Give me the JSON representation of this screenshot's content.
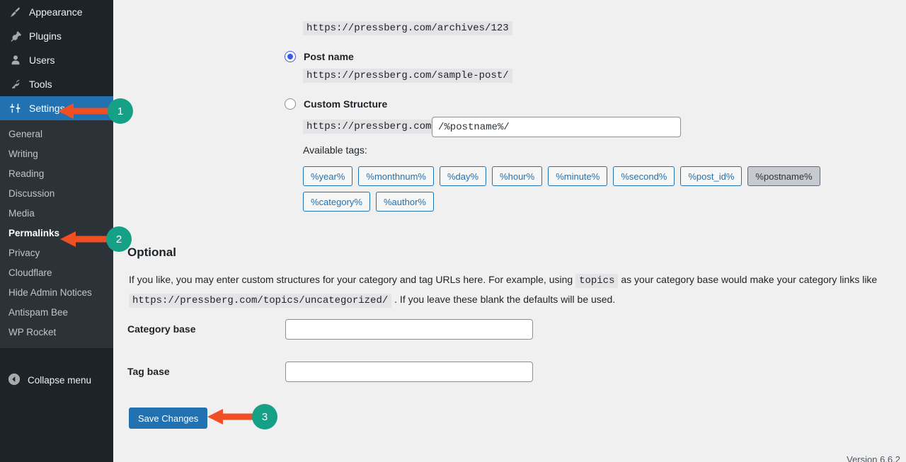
{
  "sidebar": {
    "menu": [
      {
        "label": "Appearance",
        "icon": "paintbrush-icon",
        "active": false
      },
      {
        "label": "Plugins",
        "icon": "plug-icon",
        "active": false
      },
      {
        "label": "Users",
        "icon": "user-icon",
        "active": false
      },
      {
        "label": "Tools",
        "icon": "wrench-icon",
        "active": false
      },
      {
        "label": "Settings",
        "icon": "sliders-icon",
        "active": true
      }
    ],
    "submenu": [
      {
        "label": "General",
        "current": false
      },
      {
        "label": "Writing",
        "current": false
      },
      {
        "label": "Reading",
        "current": false
      },
      {
        "label": "Discussion",
        "current": false
      },
      {
        "label": "Media",
        "current": false
      },
      {
        "label": "Permalinks",
        "current": true
      },
      {
        "label": "Privacy",
        "current": false
      },
      {
        "label": "Cloudflare",
        "current": false
      },
      {
        "label": "Hide Admin Notices",
        "current": false
      },
      {
        "label": "Antispam Bee",
        "current": false
      },
      {
        "label": "WP Rocket",
        "current": false
      }
    ],
    "collapse_label": "Collapse menu",
    "collapse_icon": "chevron-left-circle-icon"
  },
  "permalinks": {
    "numeric_example_url": "https://pressberg.com/archives/123",
    "post_name": {
      "label": "Post name",
      "selected": true,
      "example_url": "https://pressberg.com/sample-post/"
    },
    "custom_structure": {
      "label": "Custom Structure",
      "selected": false,
      "url_prefix": "https://pressberg.com",
      "value": "/%postname%/"
    },
    "available_tags_label": "Available tags:",
    "tags_row1": [
      {
        "label": "%year%",
        "selected": false
      },
      {
        "label": "%monthnum%",
        "selected": false
      },
      {
        "label": "%day%",
        "selected": false
      },
      {
        "label": "%hour%",
        "selected": false
      },
      {
        "label": "%minute%",
        "selected": false
      },
      {
        "label": "%second%",
        "selected": false
      },
      {
        "label": "%post_id%",
        "selected": false
      },
      {
        "label": "%postname%",
        "selected": true
      }
    ],
    "tags_row2": [
      {
        "label": "%category%",
        "selected": false
      },
      {
        "label": "%author%",
        "selected": false
      }
    ]
  },
  "optional": {
    "heading": "Optional",
    "desc_part1": "If you like, you may enter custom structures for your category and tag URLs here. For example, using",
    "desc_code1": "topics",
    "desc_part2": "as your category base would make your category links like",
    "desc_code2": "https://pressberg.com/topics/uncategorized/",
    "desc_part3": ". If you leave these blank the defaults will be used.",
    "category_base": {
      "label": "Category base",
      "value": "",
      "placeholder": ""
    },
    "tag_base": {
      "label": "Tag base",
      "value": "",
      "placeholder": ""
    }
  },
  "save_label": "Save Changes",
  "version": "Version 6.6.2",
  "annotations": {
    "badge1": "1",
    "badge2": "2",
    "badge3": "3",
    "arrow_color": "#f04e23",
    "badge_color": "#16a085"
  }
}
